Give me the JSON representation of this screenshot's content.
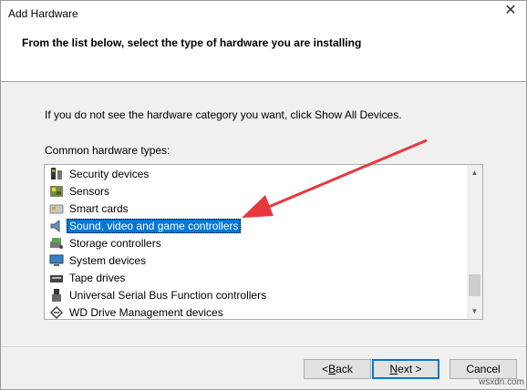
{
  "window": {
    "title": "Add Hardware",
    "close_label": "✕"
  },
  "header": {
    "heading": "From the list below, select the type of hardware you are installing"
  },
  "body": {
    "instruction": "If you do not see the hardware category you want, click Show All Devices.",
    "list_label": "Common hardware types:"
  },
  "list": {
    "items": [
      {
        "label": "Security devices",
        "icon": "security-devices-icon"
      },
      {
        "label": "Sensors",
        "icon": "sensors-icon"
      },
      {
        "label": "Smart cards",
        "icon": "smart-card-icon"
      },
      {
        "label": "Sound, video and game controllers",
        "icon": "speaker-icon",
        "selected": true
      },
      {
        "label": "Storage controllers",
        "icon": "storage-controller-icon"
      },
      {
        "label": "System devices",
        "icon": "system-devices-icon"
      },
      {
        "label": "Tape drives",
        "icon": "tape-drive-icon"
      },
      {
        "label": "Universal Serial Bus Function controllers",
        "icon": "usb-icon"
      },
      {
        "label": "WD Drive Management devices",
        "icon": "wd-drive-icon"
      }
    ]
  },
  "buttons": {
    "back_mnemonic": "B",
    "back_rest": "ack",
    "back_prefix": "< ",
    "next_mnemonic": "N",
    "next_rest": "ext >",
    "cancel": "Cancel"
  },
  "watermark": "wsxdn.com",
  "colors": {
    "selection": "#0078d7",
    "arrow": "#e8383d"
  }
}
